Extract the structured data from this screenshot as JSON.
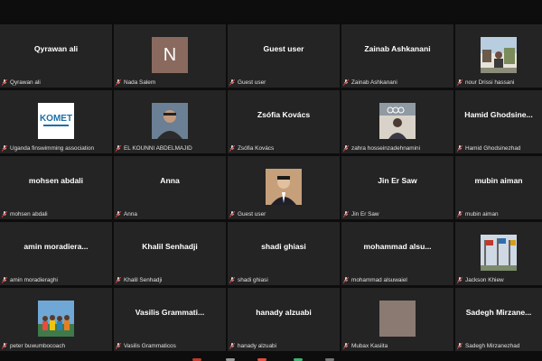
{
  "tiles": [
    {
      "center": "Qyrawan ali",
      "footer": "Qyrawan ali",
      "type": "name"
    },
    {
      "center": "N",
      "footer": "Nada Salem",
      "type": "letter",
      "color": "#8a6a5e"
    },
    {
      "center": "Guest user",
      "footer": "Guest user",
      "type": "name"
    },
    {
      "center": "Zainab Ashkanani",
      "footer": "Zainab Ashkanani",
      "type": "name"
    },
    {
      "center": "",
      "footer": "nour Drissi hassani",
      "type": "photo",
      "photo": "outdoor-photo"
    },
    {
      "center": "",
      "footer": "Uganda finswimming association",
      "type": "photo",
      "photo": "komet-logo"
    },
    {
      "center": "",
      "footer": "EL KOUNNI ABDELMAJID",
      "type": "photo",
      "photo": "man-photo"
    },
    {
      "center": "Zsófia Kovács",
      "footer": "Zsófia Kovács",
      "type": "name"
    },
    {
      "center": "",
      "footer": "zahra hosseinzadehnamini",
      "type": "photo",
      "photo": "olympic-photo"
    },
    {
      "center": "Hamid  Ghodsine...",
      "footer": "Hamid Ghodsinezhad",
      "type": "name"
    },
    {
      "center": "mohsen abdali",
      "footer": "mohsen abdali",
      "type": "name"
    },
    {
      "center": "Anna",
      "footer": "Anna",
      "type": "name"
    },
    {
      "center": "",
      "footer": "Guest user",
      "type": "photo",
      "photo": "suit-photo"
    },
    {
      "center": "Jin Er Saw",
      "footer": "Jin Er Saw",
      "type": "name"
    },
    {
      "center": "mubin aiman",
      "footer": "mubin aiman",
      "type": "name"
    },
    {
      "center": "amin  moradiera...",
      "footer": "amin moradieraghi",
      "type": "name"
    },
    {
      "center": "Khalil Senhadji",
      "footer": "Khalil Senhadji",
      "type": "name"
    },
    {
      "center": "shadi ghiasi",
      "footer": "shadi ghiasi",
      "type": "name"
    },
    {
      "center": "mohammad  alsu...",
      "footer": "mohammad alsuwaiel",
      "type": "name"
    },
    {
      "center": "",
      "footer": "Jackson Khiew",
      "type": "photo",
      "photo": "flags-photo"
    },
    {
      "center": "",
      "footer": "peter buwumbocoach",
      "type": "photo",
      "photo": "group-photo"
    },
    {
      "center": "Vasilis  Grammati...",
      "footer": "Vasilis Grammaticos",
      "type": "name"
    },
    {
      "center": "hanady alzuabi",
      "footer": "hanady alzuabi",
      "type": "name"
    },
    {
      "center": "",
      "footer": "Mubax Kasiita",
      "type": "photo",
      "photo": "blank-photo"
    },
    {
      "center": "Sadegh  Mirzane...",
      "footer": "Sadegh Mirzanezhad",
      "type": "name"
    }
  ],
  "komet_logo_text": "KOMET",
  "muted_icon": "muted-mic-icon"
}
